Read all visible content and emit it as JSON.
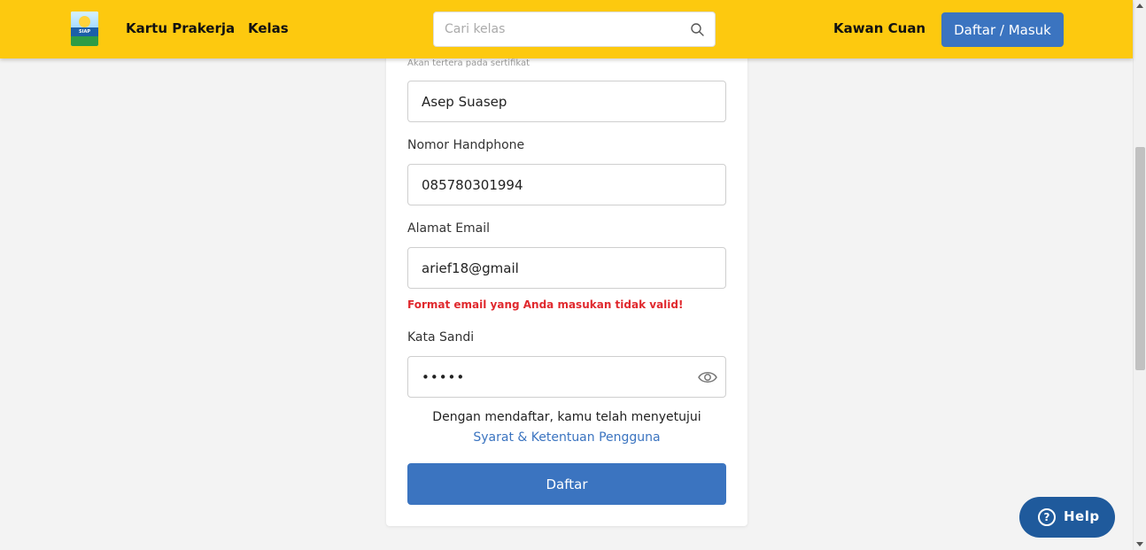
{
  "header": {
    "logo_text": "SIAP KERJA",
    "nav": [
      "Kartu Prakerja",
      "Kelas"
    ],
    "search_placeholder": "Cari kelas",
    "partner_link": "Kawan Cuan",
    "login_button": "Daftar / Masuk",
    "bg_color": "#fdc90f"
  },
  "form": {
    "name_hint": "Akan tertera pada sertifikat",
    "name_value": "Asep Suasep",
    "phone_label": "Nomor Handphone",
    "phone_value": "085780301994",
    "email_label": "Alamat Email",
    "email_value": "arief18@gmail",
    "email_error": "Format email yang Anda masukan tidak valid!",
    "password_label": "Kata Sandi",
    "password_value": "•••••",
    "terms_text": "Dengan mendaftar, kamu telah menyetujui",
    "terms_link": "Syarat & Ketentuan Pengguna",
    "submit_label": "Daftar"
  },
  "help": {
    "label": "Help",
    "icon": "question-icon"
  },
  "colors": {
    "primary": "#3b74c0",
    "error": "#e0292e"
  }
}
